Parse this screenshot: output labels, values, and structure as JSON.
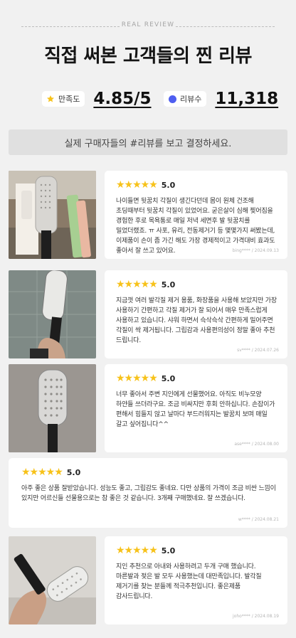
{
  "header": {
    "eyebrow": "REAL REVIEW",
    "title": "직접 써본 고객들의 찐 리뷰"
  },
  "stats": [
    {
      "icon": "star-icon",
      "label": "만족도",
      "value": "4.85/5"
    },
    {
      "icon": "dot-icon",
      "label": "리뷰수",
      "value": "11,318"
    }
  ],
  "banner": "실제 구매자들의 #리뷰를 보고 결정하세요.",
  "colors": {
    "accent_star": "#f7c21a",
    "accent_blue": "#4e5ef0"
  },
  "reviews": [
    {
      "stars": "★★★★★",
      "score": "5.0",
      "text": "나이들면 뒷꿈치 각질이 생긴다던데 몸이 원체 건조해 초딩때부터 뒷꿈치 각질이 있었어요. 굳은살이 심해 찢어짐을 경험한 후로 목욕통로 매일 저녁 세면후 발 뒷꿈치를 밀었더랬죠. ㅠ 사포, 유리, 전동제거기 등 몇몇가지 써봤는데, 이제품이 손이 좀 가긴 해도 가장 경제적이고 가격대비 효과도 좋아서 잘 쓰고 있어요.",
      "meta": "bing**** / 2024.09.13"
    },
    {
      "stars": "★★★★★",
      "score": "5.0",
      "text": "지금껏 여러 발각질 제거 용품, 화장품을 사용해 보았지만 가장 사용하기 간편하고 각질 제거가 잘 되어서 매우 만족스럽게 사용하고 있습니다. 샤워 하면서 슥삭슥삭 간편하게 밀어주면 각질이 싹 제거됩니다. 그립감과 사용편의성이 정말 좋아 추천 드립니다.",
      "meta": "sv**** / 2024.07.26"
    },
    {
      "stars": "★★★★★",
      "score": "5.0",
      "text": "너무 좋아서 주변 지인에게 선물했어요. 아직도 비누모양 하얀들 쓰더라구요. 조금 비싸지만 후회 안하십니다. 손잡이가 편해서 힘들지 않고 날마다 부드러워지는 발꿈치 보며 매일 갈고 싶어집니다^^",
      "meta": "ase**** / 2024.08.00"
    },
    {
      "stars": "★★★★★",
      "score": "5.0",
      "text": "아주 좋은 상품 잘받았습니다. 성능도 좋고, 그립감도 좋네요. 다만 상품의 가격이 조금 비싼 느낌이 있지만 어르신들 선물용으로는 참 좋은 것 같습니다. 3개째 구매했네요. 잘 쓰겠습니다.",
      "meta": "w**** / 2024.08.21"
    },
    {
      "stars": "★★★★★",
      "score": "5.0",
      "text": "지인 추천으로 아내와 사용하려고 두개 구매 했습니다. 마른발과 젖은 발 모두 사용했는데 대만족입니다. 발각질 제거기를 찾는 분들께 적극추천입니다. 좋은제품 감사드립니다.",
      "meta": "joho**** / 2024.08.19"
    }
  ]
}
